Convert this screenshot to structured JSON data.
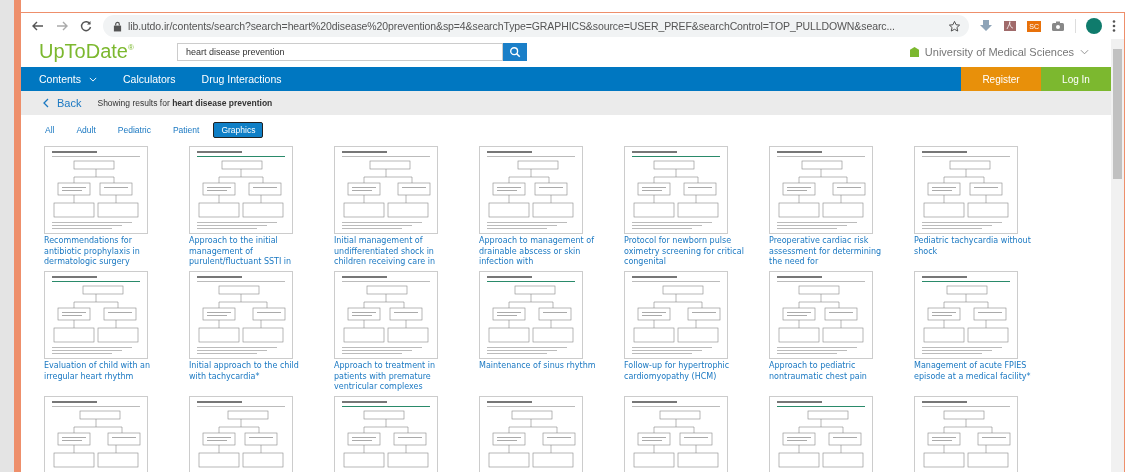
{
  "browser": {
    "url": "lib.utdo.ir/contents/search?search=heart%20disease%20prevention&sp=4&searchType=GRAPHICS&source=USER_PREF&searchControl=TOP_PULLDOWN&searc...",
    "extension_badge": "SC"
  },
  "header": {
    "logo": "UpToDate$^{®}$",
    "search_value": "heart disease prevention",
    "institution": "University of Medical Sciences"
  },
  "nav": {
    "items": [
      {
        "label": "Contents",
        "dropdown": true
      },
      {
        "label": "Calculators",
        "dropdown": false
      },
      {
        "label": "Drug Interactions",
        "dropdown": false
      }
    ],
    "register": "Register",
    "login": "Log In"
  },
  "results_bar": {
    "back": "Back",
    "summary": "Showing results for **heart disease prevention**"
  },
  "filters": [
    {
      "label": "All",
      "selected": false
    },
    {
      "label": "Adult",
      "selected": false
    },
    {
      "label": "Pediatric",
      "selected": false
    },
    {
      "label": "Patient",
      "selected": false
    },
    {
      "label": "Graphics",
      "selected": true
    }
  ],
  "results": [
    {
      "kind": "titled",
      "title": "Recommendations for antibiotic prophylaxis in dermatologic surgery"
    },
    {
      "kind": "titled",
      "title": "Approach to the initial management of purulent/fluctuant SSTI in"
    },
    {
      "kind": "titled",
      "title": "Initial management of undifferentiated shock in children receiving care in"
    },
    {
      "kind": "titled",
      "title": "Approach to management of drainable abscess or skin infection with"
    },
    {
      "kind": "titled",
      "title": "Protocol for newborn pulse oximetry screening for critical congenital"
    },
    {
      "kind": "titled",
      "title": "Preoperative cardiac risk assessment for determining the need for"
    },
    {
      "kind": "titled",
      "title": "Pediatric tachycardia without shock"
    },
    {
      "kind": "titled",
      "title": "Evaluation of child with an irregular heart rhythm"
    },
    {
      "kind": "titled",
      "title": "Initial approach to the child with tachycardia*"
    },
    {
      "kind": "titled",
      "title": "Approach to treatment in patients with premature ventricular complexes"
    },
    {
      "kind": "titled",
      "title": "Maintenance of sinus rhythm"
    },
    {
      "kind": "titled",
      "title": "Follow-up for hypertrophic cardiomyopathy (HCM)"
    },
    {
      "kind": "titled",
      "title": "Approach to pediatric nontraumatic chest pain"
    },
    {
      "kind": "titled",
      "title": "Management of acute FPIES episode at a medical facility*"
    },
    {
      "kind": "cut_off"
    },
    {
      "kind": "cut_off"
    },
    {
      "kind": "cut_off"
    },
    {
      "kind": "cut_off"
    },
    {
      "kind": "cut_off"
    },
    {
      "kind": "cut_off"
    },
    {
      "kind": "cut_off"
    }
  ]
}
